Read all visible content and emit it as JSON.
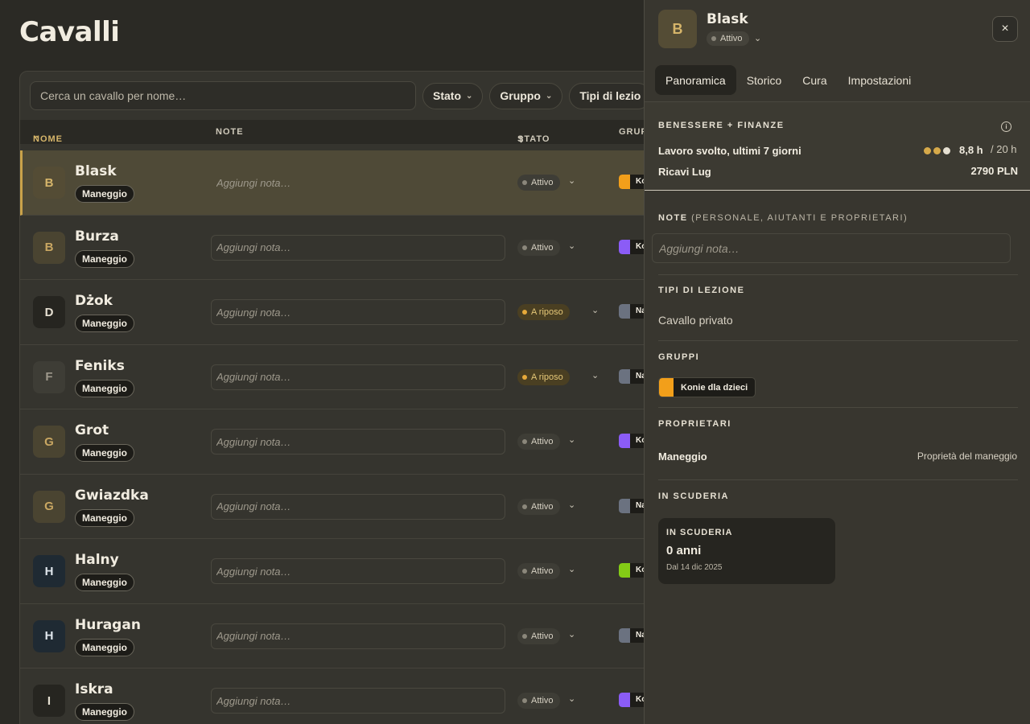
{
  "page": {
    "title": "Cavalli"
  },
  "toolbar": {
    "search_placeholder": "Cerca un cavallo per nome…",
    "filters": [
      "Stato",
      "Gruppo",
      "Tipi di lezio"
    ]
  },
  "table": {
    "headers": {
      "name": "NOME",
      "note": "NOTE",
      "status": "STATO",
      "group": "GRUP"
    },
    "note_placeholder": "Aggiungi nota…",
    "rows": [
      {
        "initial": "B",
        "name": "Blask",
        "owner": "Maneggio",
        "status": "Attivo",
        "status_kind": "active",
        "avatar_bg": "#544c35",
        "avatar_fg": "#d6b56a",
        "group_color": "#f29f1a",
        "group_label": "Ko"
      },
      {
        "initial": "B",
        "name": "Burza",
        "owner": "Maneggio",
        "status": "Attivo",
        "status_kind": "active",
        "avatar_bg": "#4a4431",
        "avatar_fg": "#c9a762",
        "group_color": "#8b5cf6",
        "group_label": "Ko"
      },
      {
        "initial": "D",
        "name": "Dżok",
        "owner": "Maneggio",
        "status": "A riposo",
        "status_kind": "rest",
        "avatar_bg": "#262520",
        "avatar_fg": "#e6e0d2",
        "group_color": "#6b7280",
        "group_label": "Na"
      },
      {
        "initial": "F",
        "name": "Feniks",
        "owner": "Maneggio",
        "status": "A riposo",
        "status_kind": "rest",
        "avatar_bg": "#3e3d36",
        "avatar_fg": "#9e998c",
        "group_color": "#6b7280",
        "group_label": "Na"
      },
      {
        "initial": "G",
        "name": "Grot",
        "owner": "Maneggio",
        "status": "Attivo",
        "status_kind": "active",
        "avatar_bg": "#4a4431",
        "avatar_fg": "#c9a762",
        "group_color": "#8b5cf6",
        "group_label": "Ko"
      },
      {
        "initial": "G",
        "name": "Gwiazdka",
        "owner": "Maneggio",
        "status": "Attivo",
        "status_kind": "active",
        "avatar_bg": "#4a4431",
        "avatar_fg": "#c9a762",
        "group_color": "#6b7280",
        "group_label": "Na"
      },
      {
        "initial": "H",
        "name": "Halny",
        "owner": "Maneggio",
        "status": "Attivo",
        "status_kind": "active",
        "avatar_bg": "#1f2a33",
        "avatar_fg": "#dfe6ec",
        "group_color": "#84cc16",
        "group_label": "Ko"
      },
      {
        "initial": "H",
        "name": "Huragan",
        "owner": "Maneggio",
        "status": "Attivo",
        "status_kind": "active",
        "avatar_bg": "#1f2a33",
        "avatar_fg": "#dfe6ec",
        "group_color": "#6b7280",
        "group_label": "Na"
      },
      {
        "initial": "I",
        "name": "Iskra",
        "owner": "Maneggio",
        "status": "Attivo",
        "status_kind": "active",
        "avatar_bg": "#262520",
        "avatar_fg": "#e6e0d2",
        "group_color": "#8b5cf6",
        "group_label": "Ko"
      }
    ]
  },
  "panel": {
    "initial": "B",
    "name": "Blask",
    "status": "Attivo",
    "close_icon": "×",
    "tabs": [
      "Panoramica",
      "Storico",
      "Cura",
      "Impostazioni"
    ],
    "summary": {
      "title": "BENESSERE + FINANZE",
      "work_label": "Lavoro svolto, ultimi 7 giorni",
      "work_dots": 3,
      "hours": "8,8 h",
      "hours_max": "/ 20 h",
      "revenue_label": "Ricavi Lug",
      "revenue_value": "2790 PLN"
    },
    "notes": {
      "title": "NOTE",
      "subtitle": "(PERSONALE, AIUTANTI E PROPRIETARI)",
      "placeholder": "Aggiungi nota…"
    },
    "lessons": {
      "title": "TIPI DI LEZIONE",
      "value": "Cavallo privato"
    },
    "groups": {
      "title": "GRUPPI",
      "chip": "Konie dla dzieci",
      "chip_color": "#f29f1a"
    },
    "owners": {
      "title": "PROPRIETARI",
      "name": "Maneggio",
      "type": "Proprietà del maneggio"
    },
    "stable": {
      "title": "IN SCUDERIA",
      "card_title": "IN SCUDERIA",
      "value": "0 anni",
      "since": "Dal 14 dic 2025"
    }
  },
  "colors": {
    "accent": "#d6b56a",
    "selected_row": "#4f4a37",
    "rest_dot": "#e6a93a"
  }
}
